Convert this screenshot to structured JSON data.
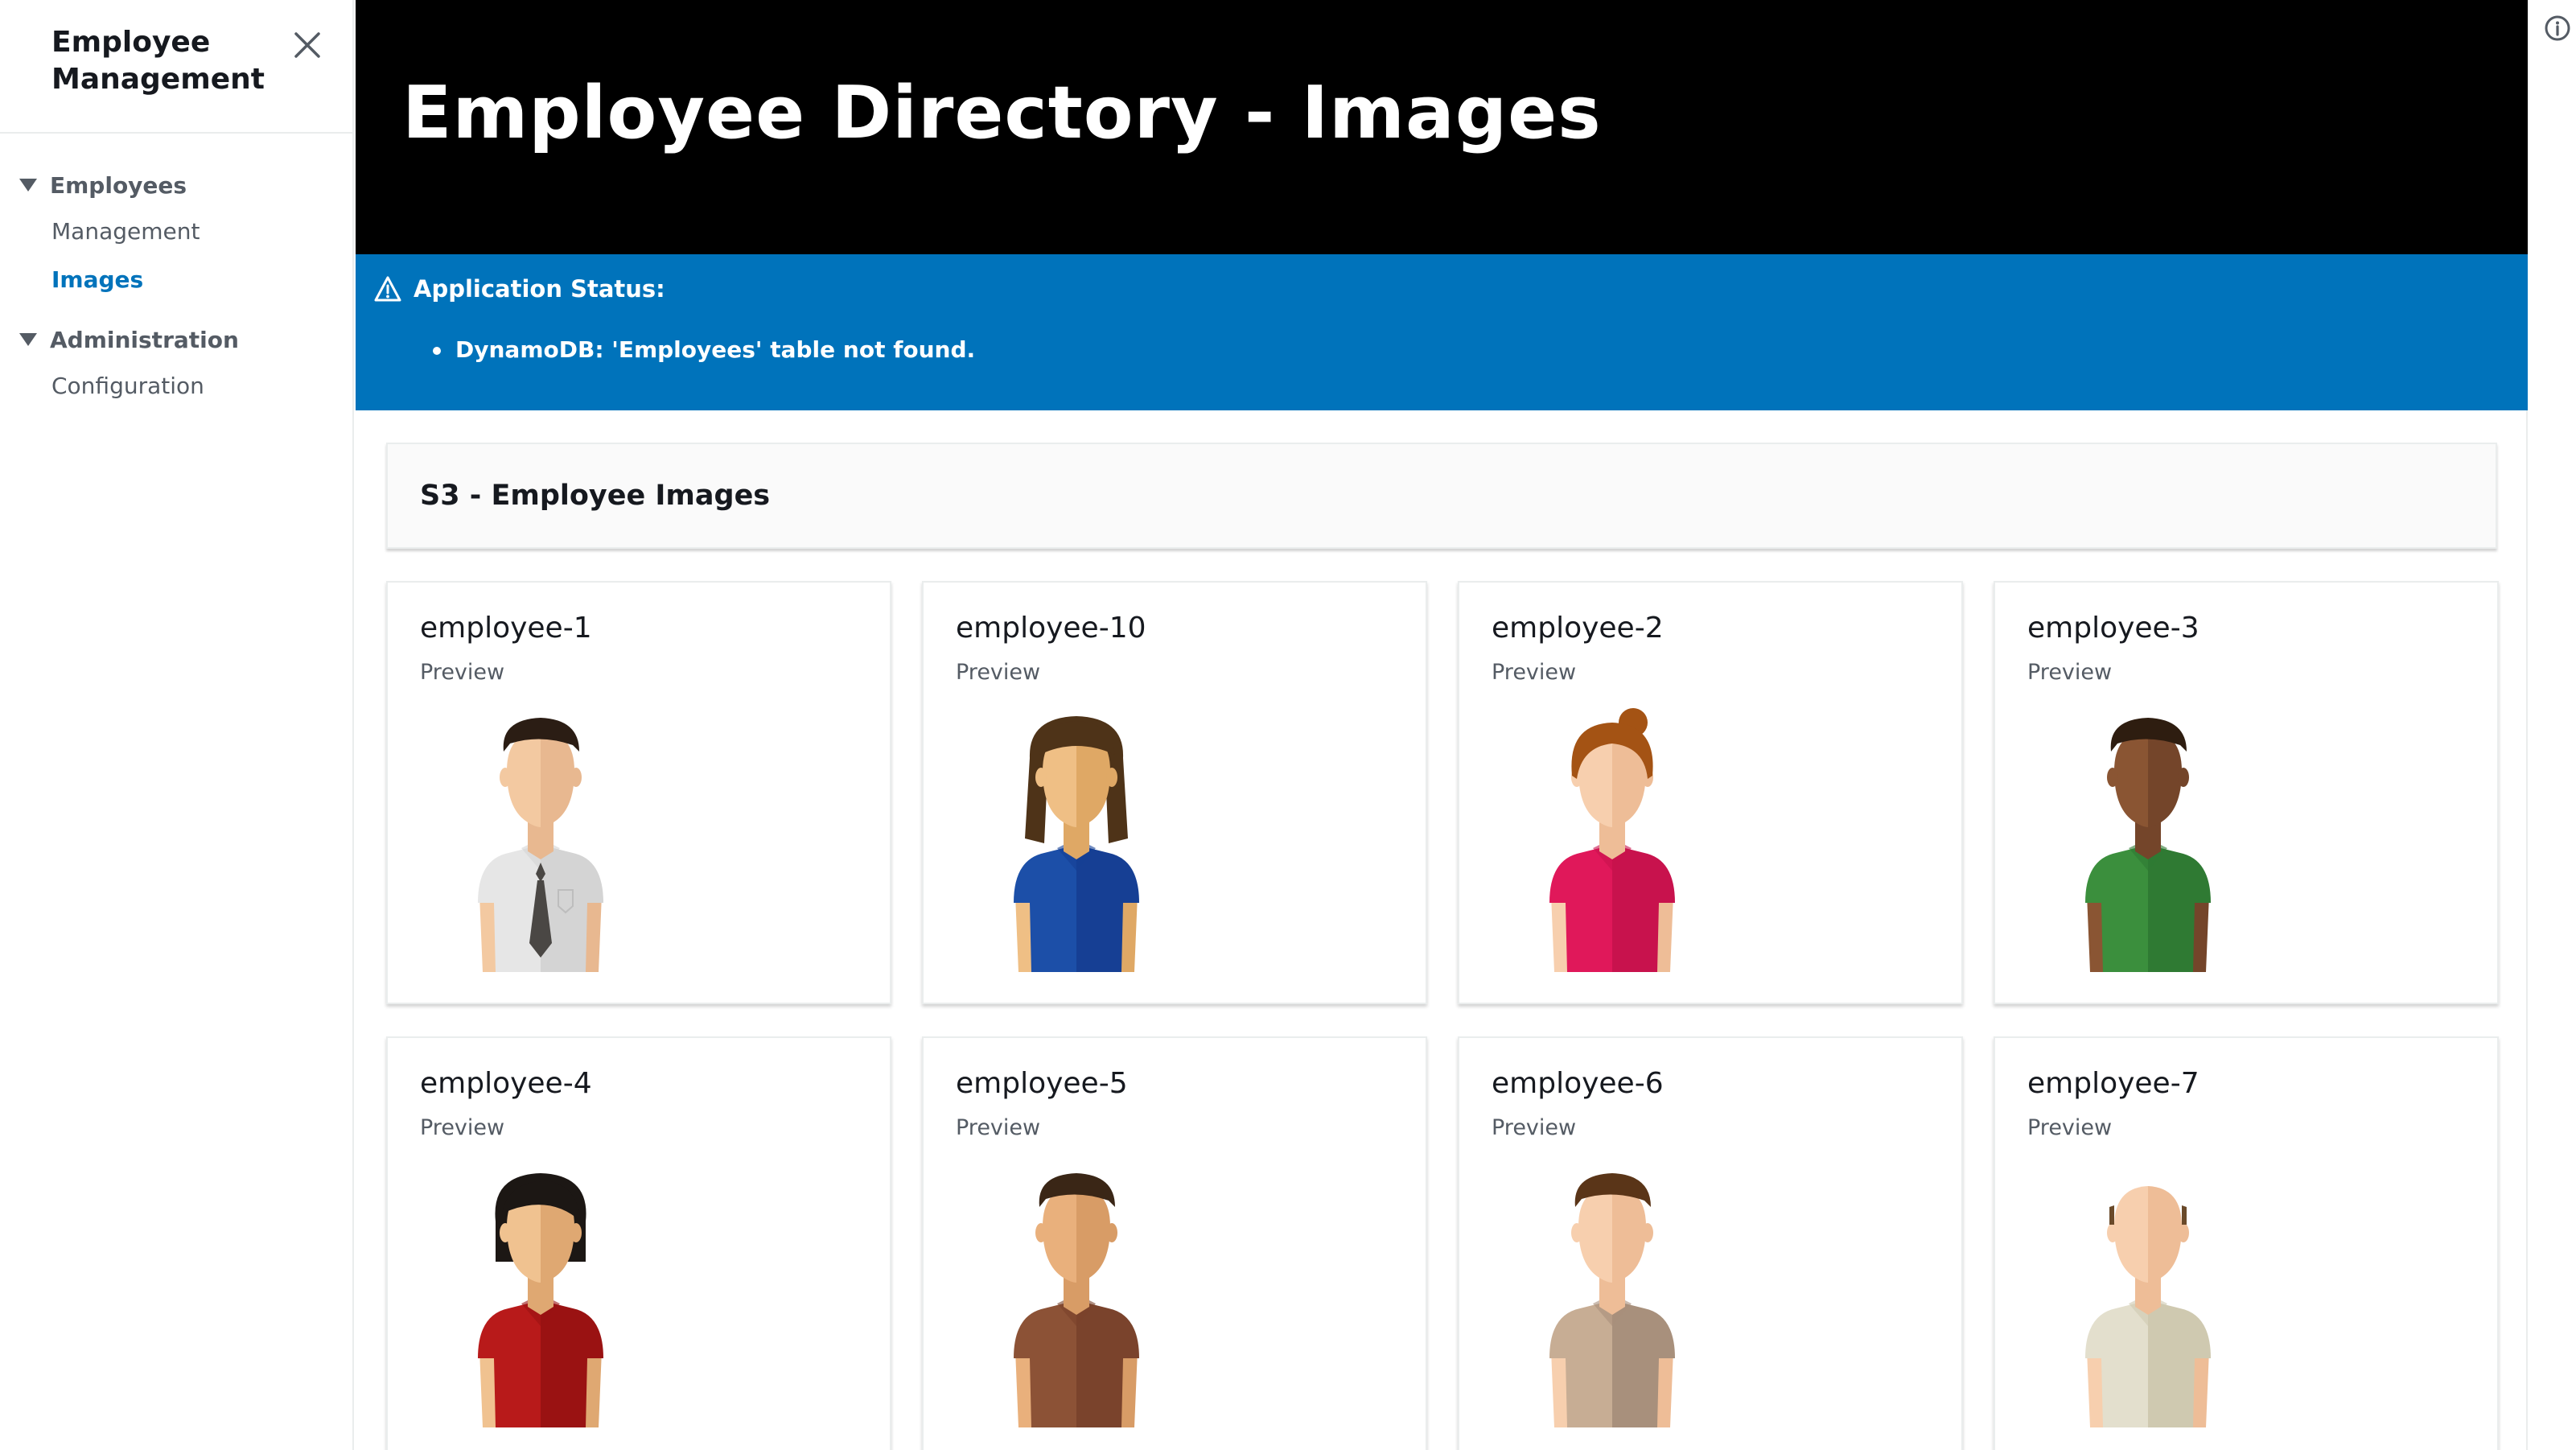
{
  "sidebar": {
    "title": "Employee Management",
    "groups": [
      {
        "label": "Employees",
        "items": [
          {
            "label": "Management"
          },
          {
            "label": "Images"
          }
        ]
      },
      {
        "label": "Administration",
        "items": [
          {
            "label": "Configuration"
          }
        ]
      }
    ],
    "active_item": "Images"
  },
  "header": {
    "title": "Employee Directory - Images"
  },
  "status": {
    "label": "Application Status:",
    "items": [
      "DynamoDB: 'Employees' table not found."
    ]
  },
  "section": {
    "title": "S3 - Employee Images"
  },
  "cards": [
    {
      "name": "employee-1",
      "sub": "Preview",
      "avatar": {
        "hair": "#2b1d14",
        "hairStyle": "short",
        "skinL": "#f3c9a1",
        "skinR": "#e8b890",
        "shirtL": "#e6e6e6",
        "shirtR": "#d4d4d4",
        "tie": "#4a4744"
      }
    },
    {
      "name": "employee-10",
      "sub": "Preview",
      "avatar": {
        "hair": "#4e3318",
        "hairStyle": "long",
        "skinL": "#efbf85",
        "skinR": "#dfa865",
        "shirtL": "#1c4fa8",
        "shirtR": "#163f94"
      }
    },
    {
      "name": "employee-2",
      "sub": "Preview",
      "avatar": {
        "hair": "#a45314",
        "hairStyle": "bun",
        "skinL": "#f7cfae",
        "skinR": "#eebd97",
        "shirtL": "#e0185a",
        "shirtR": "#c8124d"
      }
    },
    {
      "name": "employee-3",
      "sub": "Preview",
      "avatar": {
        "hair": "#2e1d10",
        "hairStyle": "short",
        "skinL": "#8a5533",
        "skinR": "#74452a",
        "shirtL": "#3b8f3d",
        "shirtR": "#2f7a33"
      }
    },
    {
      "name": "employee-4",
      "sub": "Preview",
      "avatar": {
        "hair": "#1c1714",
        "hairStyle": "bob",
        "skinL": "#f0c290",
        "skinR": "#dfa872",
        "shirtL": "#b81a1a",
        "shirtR": "#9a1212"
      }
    },
    {
      "name": "employee-5",
      "sub": "Preview",
      "avatar": {
        "hair": "#3a2616",
        "hairStyle": "short",
        "skinL": "#e9b07c",
        "skinR": "#d89c66",
        "shirtL": "#8c5236",
        "shirtR": "#7a432c"
      }
    },
    {
      "name": "employee-6",
      "sub": "Preview",
      "avatar": {
        "hair": "#5a3518",
        "hairStyle": "short",
        "skinL": "#f7cfae",
        "skinR": "#eebd97",
        "shirtL": "#c7ad94",
        "shirtR": "#a8907c"
      }
    },
    {
      "name": "employee-7",
      "sub": "Preview",
      "avatar": {
        "hair": "#6a4a2a",
        "hairStyle": "bald",
        "skinL": "#f7cfae",
        "skinR": "#eebd97",
        "shirtL": "#e3dfcd",
        "shirtR": "#cfc9b0"
      }
    }
  ],
  "colors": {
    "accent": "#0073bb",
    "header_bg": "#000000",
    "status_bg": "#0073bb"
  },
  "icons": {
    "close": "close-icon",
    "warning": "warning-icon",
    "info": "info-icon",
    "caret": "caret-down-icon"
  }
}
